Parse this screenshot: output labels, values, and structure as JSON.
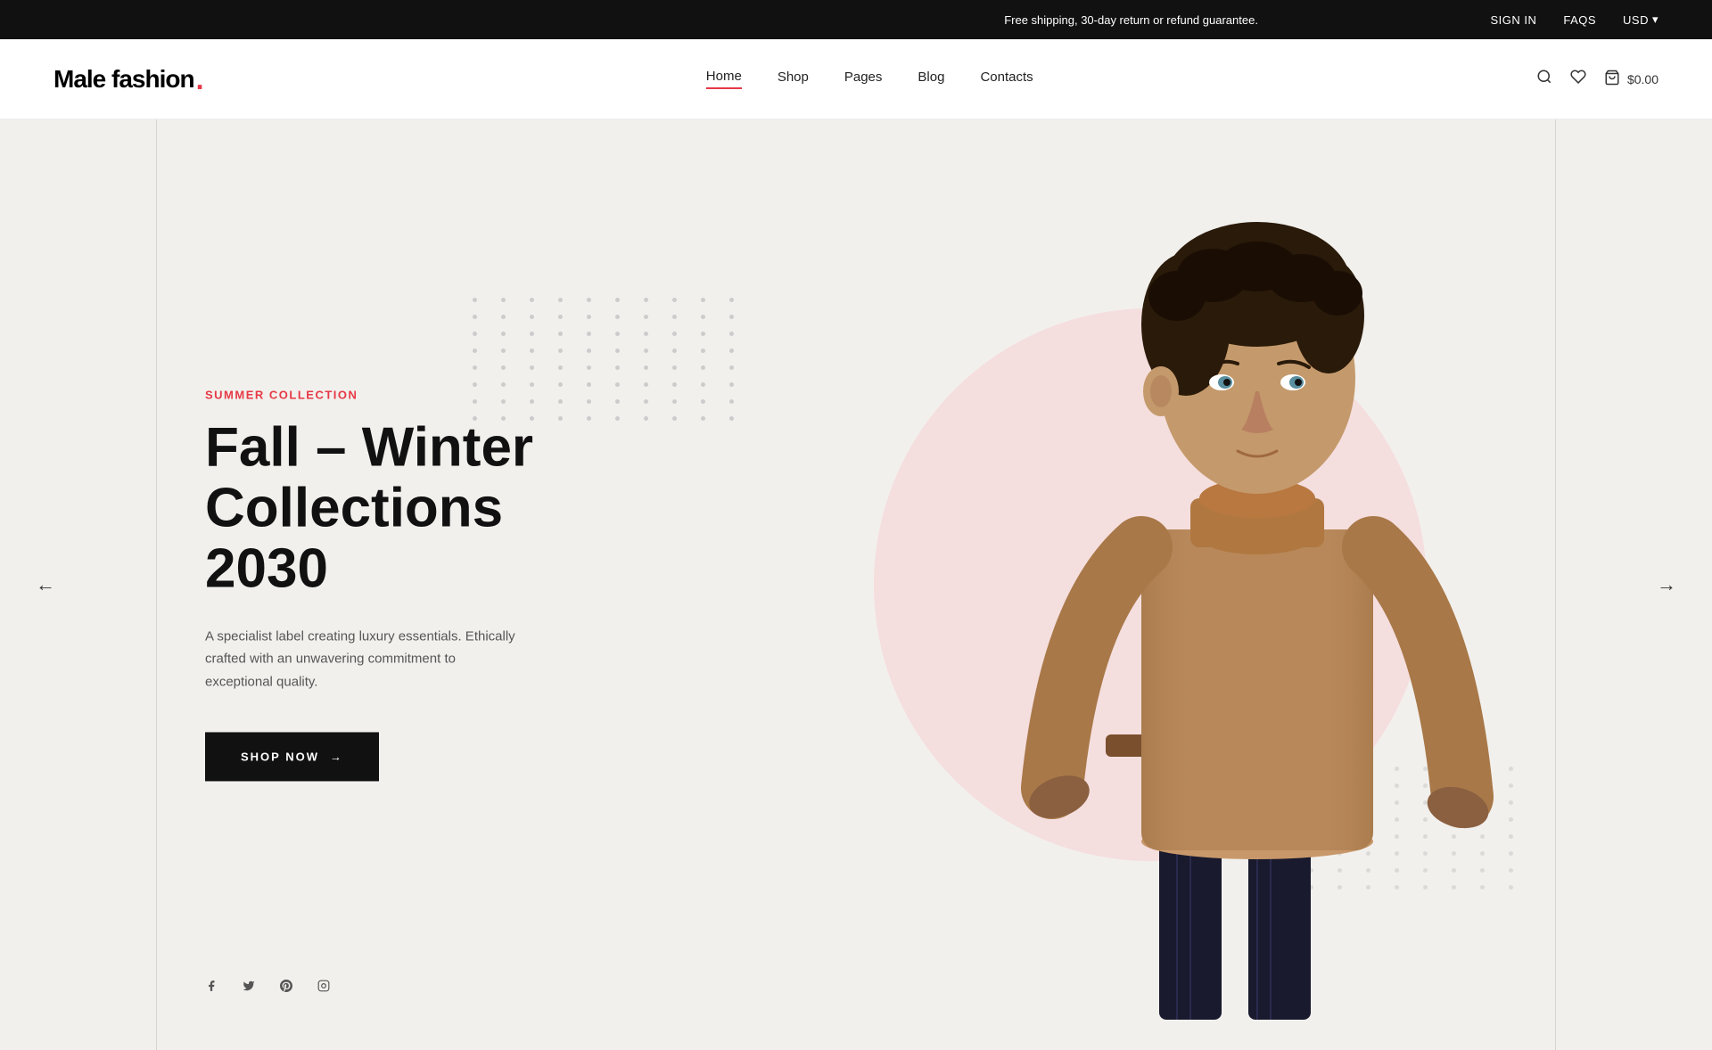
{
  "topbar": {
    "message": "Free shipping, 30-day return or refund guarantee.",
    "signin": "SIGN IN",
    "faqs": "FAQS",
    "currency": "USD",
    "currency_arrow": "▾"
  },
  "header": {
    "logo_text": "Male fashion",
    "logo_dot": ".",
    "nav": [
      {
        "label": "Home",
        "active": true
      },
      {
        "label": "Shop",
        "active": false
      },
      {
        "label": "Pages",
        "active": false
      },
      {
        "label": "Blog",
        "active": false
      },
      {
        "label": "Contacts",
        "active": false
      }
    ],
    "cart_price": "$0.00"
  },
  "hero": {
    "collection_label": "SUMMER COLLECTION",
    "title_line1": "Fall – Winter",
    "title_line2": "Collections 2030",
    "description": "A specialist label creating luxury essentials. Ethically crafted with an unwavering commitment to exceptional quality.",
    "cta_label": "SHOP NOW",
    "cta_arrow": "→",
    "arrow_left": "←",
    "arrow_right": "→"
  },
  "social": {
    "facebook": "f",
    "twitter": "t",
    "pinterest": "p",
    "instagram": "i"
  },
  "colors": {
    "accent": "#e63946",
    "dark": "#111111",
    "bg": "#f2f0ed",
    "pink_circle": "#f5dede",
    "dot": "#cccccc"
  }
}
